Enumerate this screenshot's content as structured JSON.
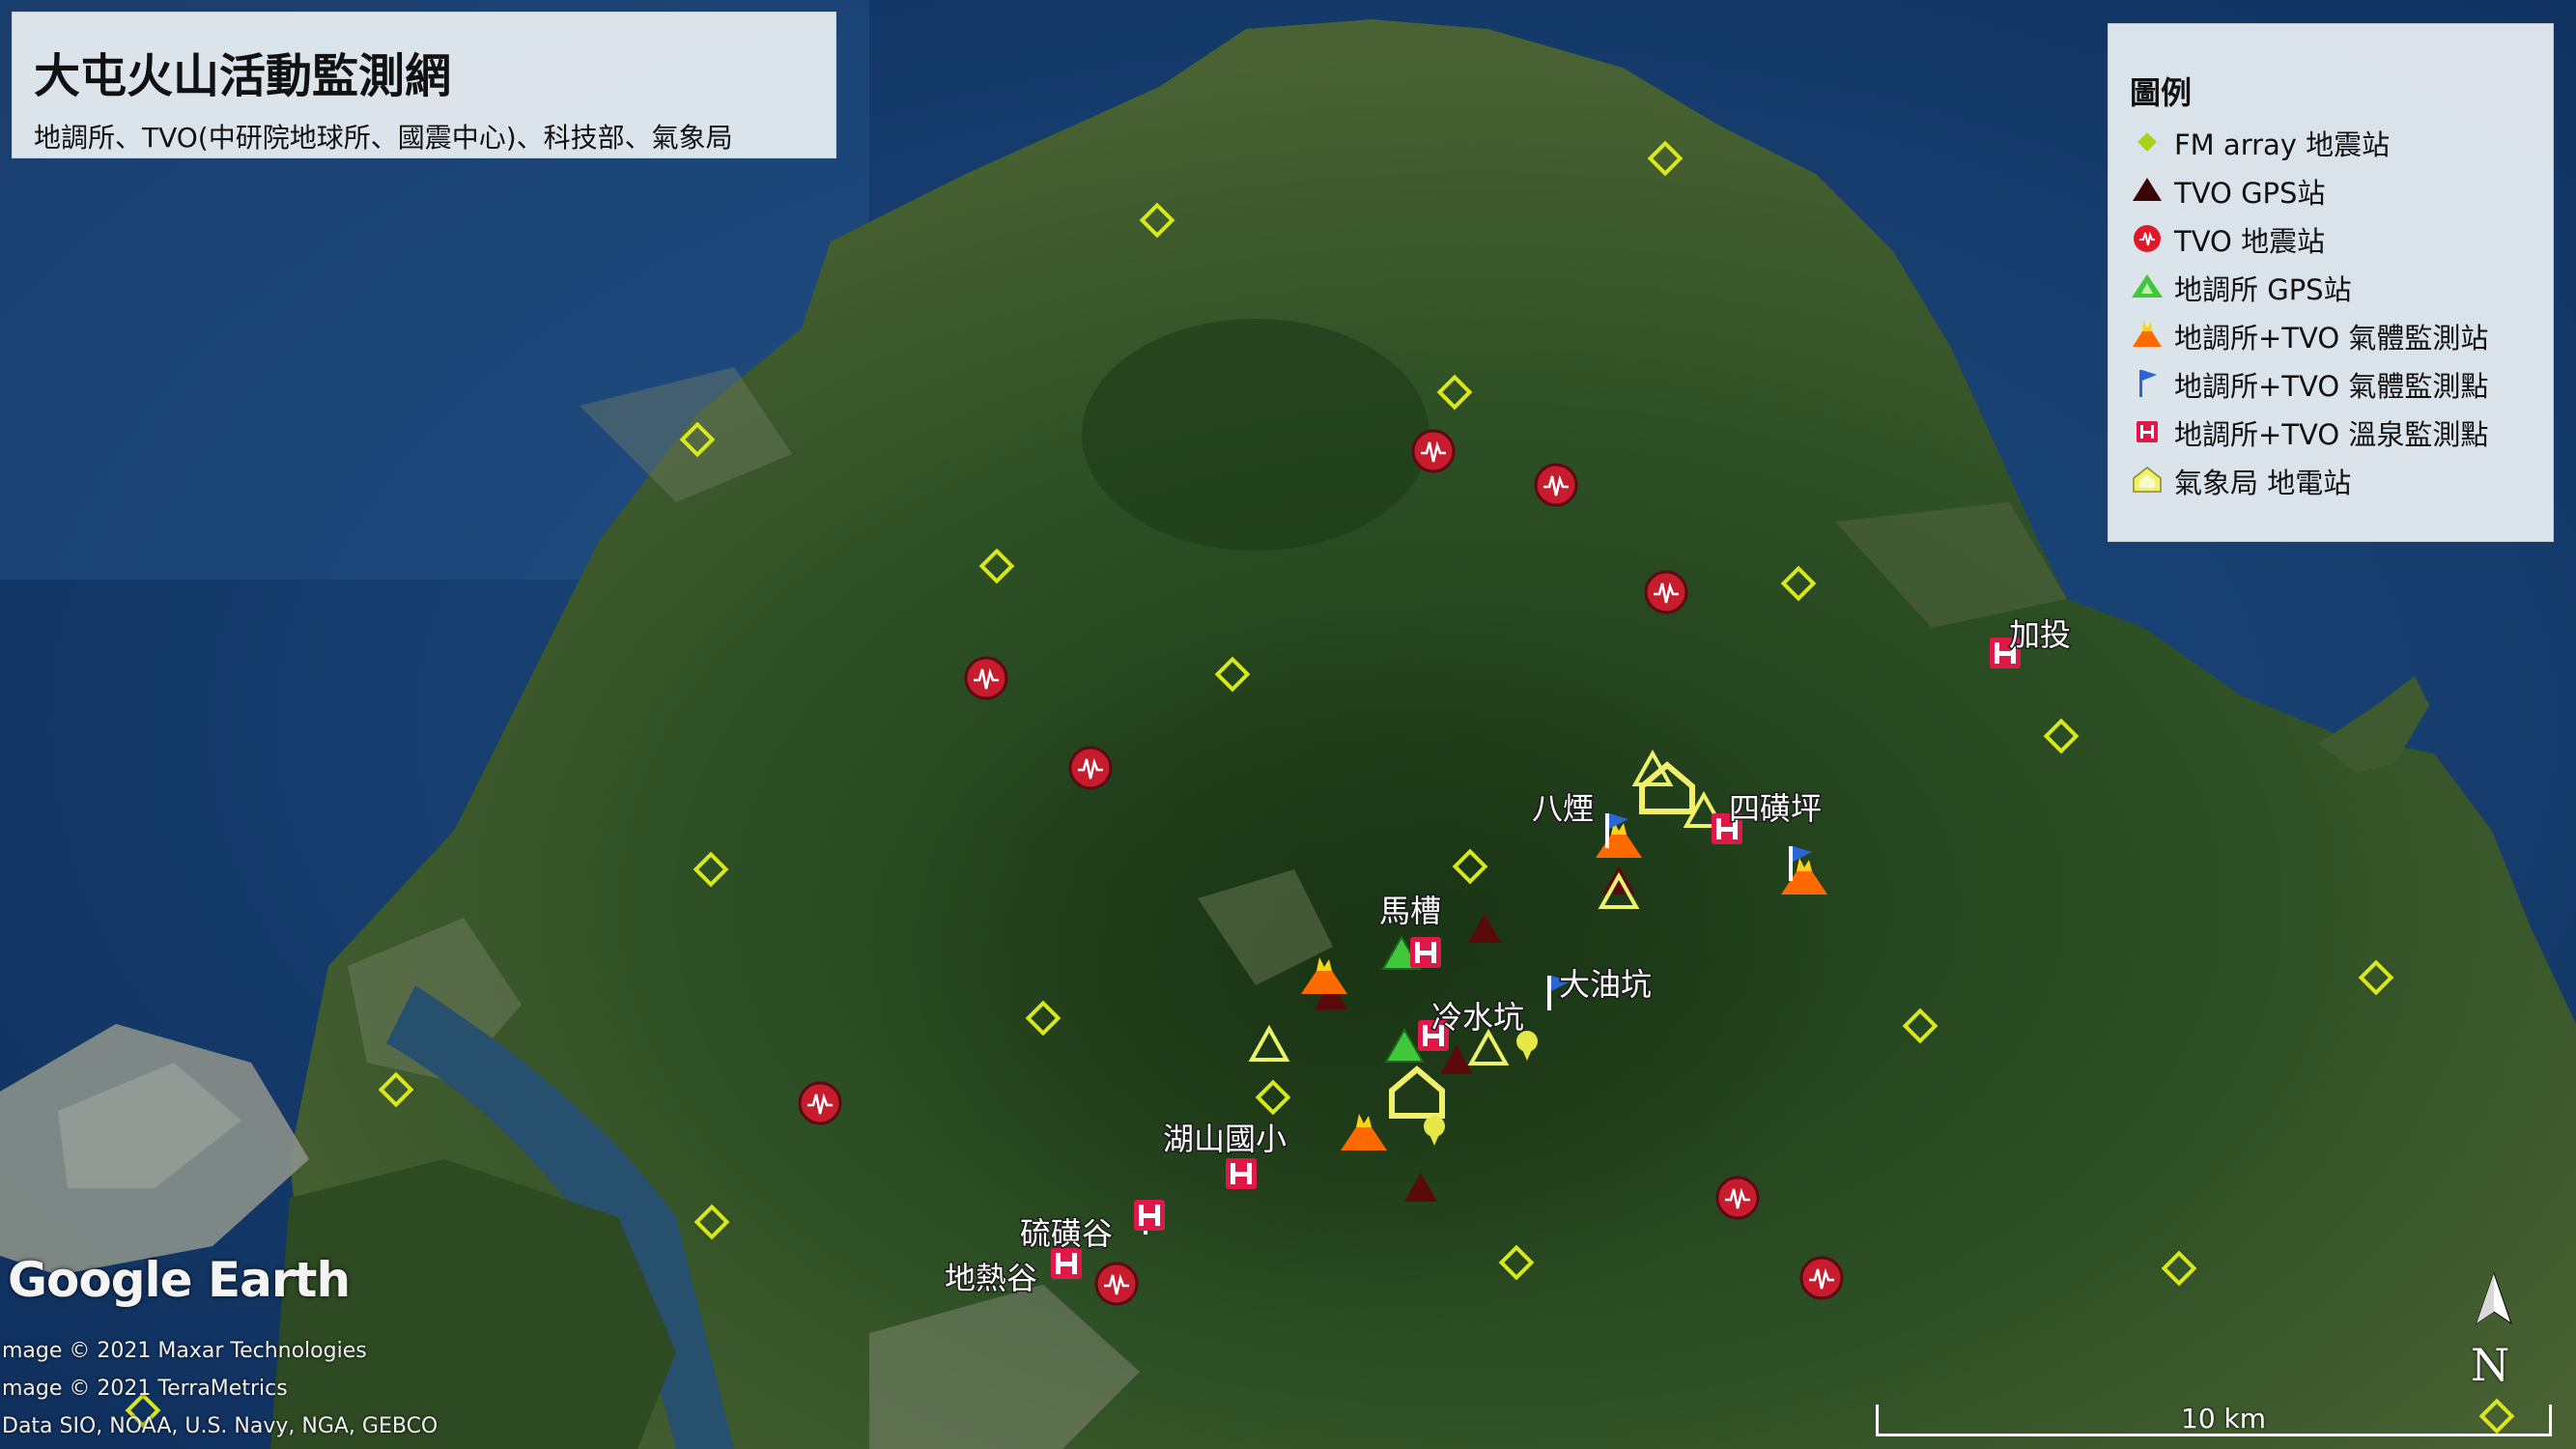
{
  "map": {
    "title": "大屯火山活動監測網",
    "subtitle": "地調所、TVO(中研院地球所、國震中心)、科技部、氣象局",
    "legend_title": "圖例",
    "legend": [
      {
        "icon": "fm-array-diamond-icon",
        "label": "FM array 地震站",
        "color": "#a8d21a"
      },
      {
        "icon": "tvo-gps-triangle-icon",
        "label": "TVO GPS站",
        "color": "#5a0a0a"
      },
      {
        "icon": "tvo-seismic-icon",
        "label": "TVO 地震站",
        "color": "#e0182a"
      },
      {
        "icon": "cgs-gps-triangle-icon",
        "label": "地調所 GPS站",
        "color": "#3fc83a"
      },
      {
        "icon": "gas-station-volcano-icon",
        "label": "地調所+TVO 氣體監測站",
        "color": "#ff6a00"
      },
      {
        "icon": "gas-point-flag-icon",
        "label": "地調所+TVO 氣體監測點",
        "color": "#2a66d8"
      },
      {
        "icon": "hot-spring-h-icon",
        "label": "地調所+TVO 溫泉監測點",
        "color": "#e0184a"
      },
      {
        "icon": "cwb-geoelectric-house-icon",
        "label": "氣象局 地電站",
        "color": "#f2f06a"
      }
    ],
    "place_labels": [
      "加投",
      "八煙",
      "四磺坪",
      "馬槽",
      "大油坑",
      "冷水坑",
      "湖山國小",
      "硫磺谷",
      "地熱谷"
    ],
    "brand": "Google Earth",
    "credits": [
      "mage © 2021 Maxar Technologies",
      "mage © 2021 TerraMetrics",
      "Data SIO, NOAA, U.S. Navy, NGA, GEBCO"
    ],
    "scale_label": "10 km",
    "north_label": "N"
  }
}
